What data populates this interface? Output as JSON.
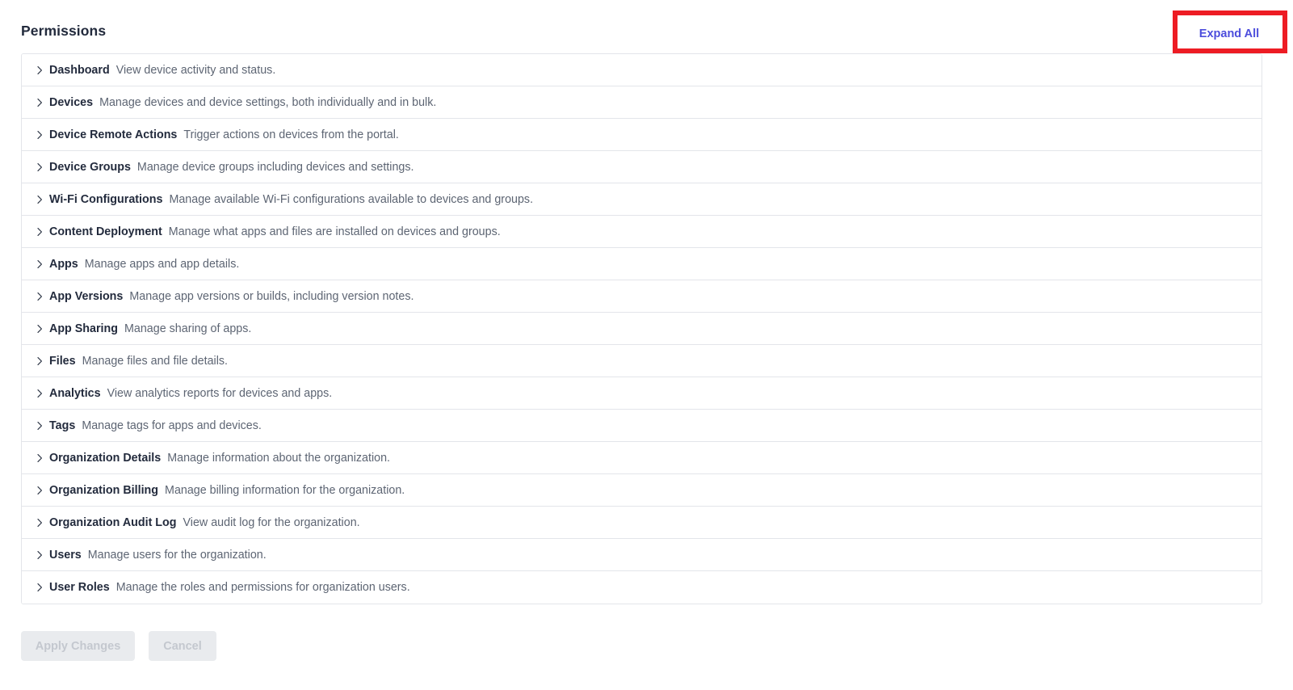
{
  "header": {
    "title": "Permissions",
    "expand_all_label": "Expand All",
    "expand_all_color": "#4c4ddc",
    "annotation_color": "#ed1c24"
  },
  "permissions": {
    "chevron_icon": "chevron-right-icon",
    "rows": [
      {
        "name": "Dashboard",
        "description": "View device activity and status."
      },
      {
        "name": "Devices",
        "description": "Manage devices and device settings, both individually and in bulk."
      },
      {
        "name": "Device Remote Actions",
        "description": "Trigger actions on devices from the portal."
      },
      {
        "name": "Device Groups",
        "description": "Manage device groups including devices and settings."
      },
      {
        "name": "Wi-Fi Configurations",
        "description": "Manage available Wi-Fi configurations available to devices and groups."
      },
      {
        "name": "Content Deployment",
        "description": "Manage what apps and files are installed on devices and groups."
      },
      {
        "name": "Apps",
        "description": "Manage apps and app details."
      },
      {
        "name": "App Versions",
        "description": "Manage app versions or builds, including version notes."
      },
      {
        "name": "App Sharing",
        "description": "Manage sharing of apps."
      },
      {
        "name": "Files",
        "description": "Manage files and file details."
      },
      {
        "name": "Analytics",
        "description": "View analytics reports for devices and apps."
      },
      {
        "name": "Tags",
        "description": "Manage tags for apps and devices."
      },
      {
        "name": "Organization Details",
        "description": "Manage information about the organization."
      },
      {
        "name": "Organization Billing",
        "description": "Manage billing information for the organization."
      },
      {
        "name": "Organization Audit Log",
        "description": "View audit log for the organization."
      },
      {
        "name": "Users",
        "description": "Manage users for the organization."
      },
      {
        "name": "User Roles",
        "description": "Manage the roles and permissions for organization users."
      }
    ]
  },
  "footer": {
    "apply_label": "Apply Changes",
    "cancel_label": "Cancel",
    "apply_disabled": true,
    "cancel_disabled": true
  }
}
